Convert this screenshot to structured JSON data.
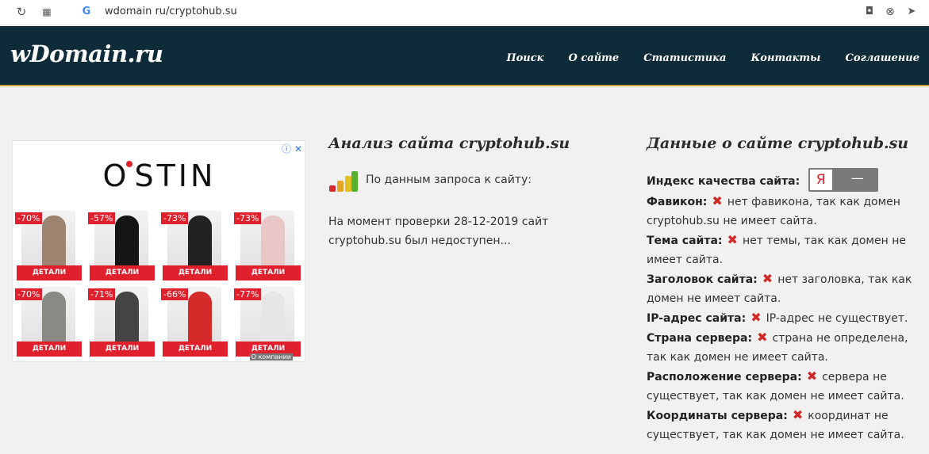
{
  "browser": {
    "url": "wdomain ru/cryptohub.su"
  },
  "header": {
    "logo": "wDomain.ru",
    "nav": [
      "Поиск",
      "О сайте",
      "Статистика",
      "Контакты",
      "Соглашение"
    ]
  },
  "ad": {
    "brand": "O'STIN",
    "tiles": [
      {
        "discount": "-70%",
        "button": "ДЕТАЛИ",
        "color": "#9c8470"
      },
      {
        "discount": "-57%",
        "button": "ДЕТАЛИ",
        "color": "#151515"
      },
      {
        "discount": "-73%",
        "button": "ДЕТАЛИ",
        "color": "#222222"
      },
      {
        "discount": "-73%",
        "button": "ДЕТАЛИ",
        "color": "#e9c7c7"
      },
      {
        "discount": "-70%",
        "button": "ДЕТАЛИ",
        "color": "#8a8a84"
      },
      {
        "discount": "-71%",
        "button": "ДЕТАЛИ",
        "color": "#444444"
      },
      {
        "discount": "-66%",
        "button": "ДЕТАЛИ",
        "color": "#d42a2a"
      },
      {
        "discount": "-77%",
        "button": "ДЕТАЛИ",
        "color": "#e6e6e6"
      }
    ],
    "about": "О компании"
  },
  "analysis": {
    "title": "Анализ сайта cryptohub.su",
    "request_text": "По данным запроса к сайту:",
    "check_text": "На момент проверки 28-12-2019 сайт cryptohub.su был недоступен..."
  },
  "site_data": {
    "title": "Данные о сайте cryptohub.su",
    "quality_label": "Индекс качества сайта:",
    "yandex_letter": "Я",
    "yandex_value": "—",
    "items": [
      {
        "label": "Фавикон:",
        "text": "нет фавикона, так как домен cryptohub.su не имеет сайта."
      },
      {
        "label": "Тема сайта:",
        "text": "нет темы, так как домен не имеет сайта."
      },
      {
        "label": "Заголовок сайта:",
        "text": "нет заголовка, так как домен не имеет сайта."
      },
      {
        "label": "IP-адрес сайта:",
        "text": "IP-адрес не существует."
      },
      {
        "label": "Страна сервера:",
        "text": "страна не определена, так как домен не имеет сайта."
      },
      {
        "label": "Расположение сервера:",
        "text": "сервера не существует, так как домен не имеет сайта."
      },
      {
        "label": "Координаты сервера:",
        "text": "координат не существует, так как домен не имеет сайта."
      }
    ]
  }
}
